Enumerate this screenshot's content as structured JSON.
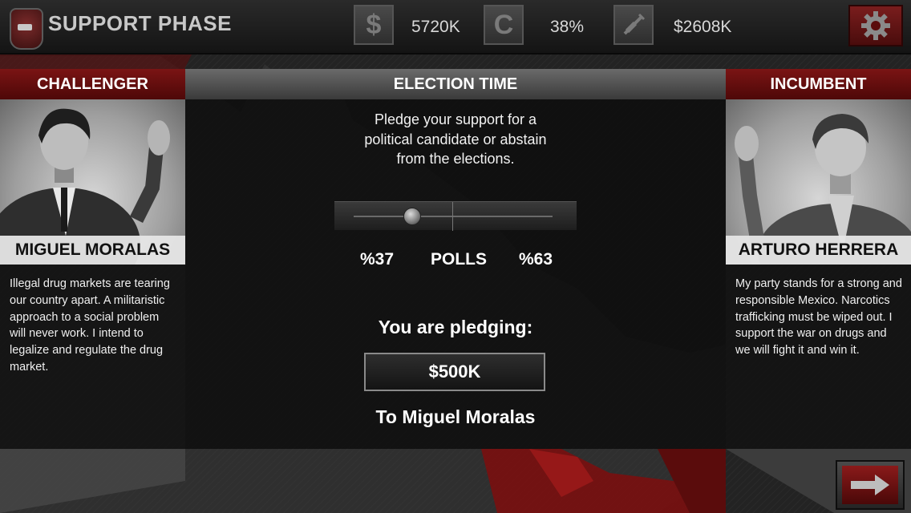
{
  "top_bar": {
    "phase_title": "SUPPORT PHASE",
    "stats": [
      {
        "icon": "dollar-icon",
        "glyph": "$",
        "value": "5720K"
      },
      {
        "icon": "cartel-c-icon",
        "glyph": "C",
        "value": "38%"
      },
      {
        "icon": "syringe-icon",
        "glyph": "",
        "value": "$2608K"
      }
    ]
  },
  "challenger": {
    "role": "CHALLENGER",
    "name": "MIGUEL MORALAS",
    "description": "Illegal drug markets are tearing our country apart. A militaristic approach to a social problem will never work. I intend to legalize and regulate the drug market."
  },
  "incumbent": {
    "role": "INCUMBENT",
    "name": "ARTURO HERRERA",
    "description": "My party stands for a strong and responsible Mexico. Narcotics trafficking must be wiped out. I support the war on drugs and we will fight it and win it."
  },
  "election": {
    "title": "ELECTION TIME",
    "intro_lines": [
      "Pledge your support for a",
      "political candidate or abstain",
      "from the elections."
    ],
    "slider_level": 0.29,
    "polls": {
      "left": "%37",
      "label": "POLLS",
      "right": "%63"
    },
    "pledge_label": "You are pledging:",
    "pledge_amount": "$500K",
    "pledge_target": "To Miguel Moralas"
  },
  "colors": {
    "accent_red": "#7a1414",
    "panel_dark": "#141414",
    "text_light": "#ffffff"
  }
}
